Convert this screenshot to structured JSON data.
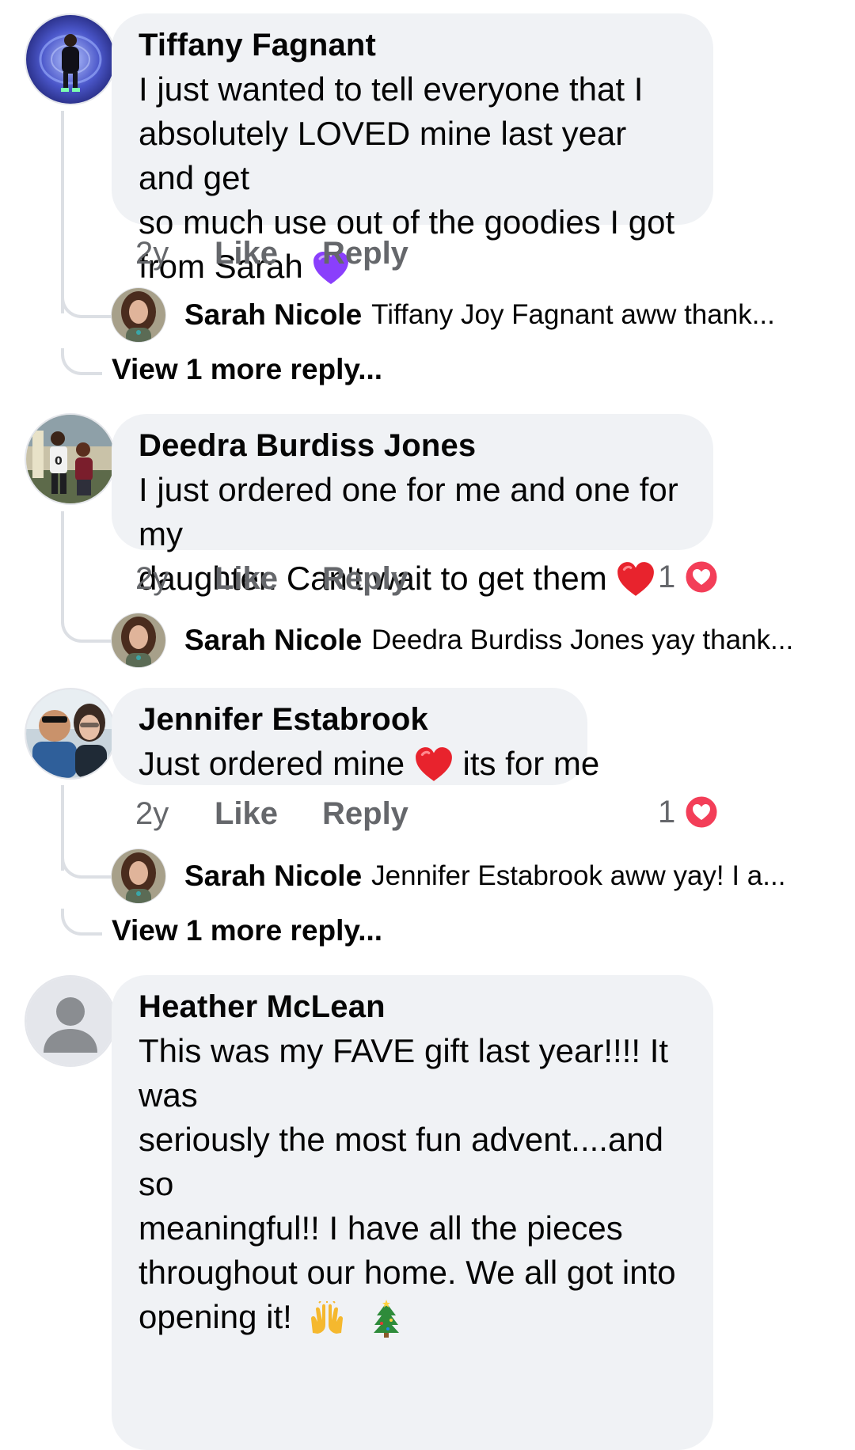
{
  "comments": [
    {
      "author": "Tiffany Fagnant",
      "text_lines": [
        "I just wanted to tell everyone that I",
        "absolutely LOVED mine last year and get",
        "so much use out of the goodies I got",
        "from Sarah"
      ],
      "emoji": "purple-heart",
      "time": "2y",
      "like": "Like",
      "reply": "Reply",
      "reply_preview": {
        "name": "Sarah Nicole",
        "text": "Tiffany Joy Fagnant aww thank..."
      },
      "view_more": "View 1 more reply..."
    },
    {
      "author": "Deedra Burdiss Jones",
      "text_lines": [
        "I just ordered one for me and one for my",
        "daughter. Can't wait to get them"
      ],
      "emoji": "red-heart",
      "time": "2y",
      "like": "Like",
      "reply": "Reply",
      "reaction_count": "1",
      "reply_preview": {
        "name": "Sarah Nicole",
        "text": "Deedra Burdiss Jones yay thank..."
      }
    },
    {
      "author": "Jennifer Estabrook",
      "text_before": "Just ordered mine",
      "text_after": "its for me",
      "emoji": "red-heart",
      "time": "2y",
      "like": "Like",
      "reply": "Reply",
      "reaction_count": "1",
      "reply_preview": {
        "name": "Sarah Nicole",
        "text": "Jennifer Estabrook aww yay! I a..."
      },
      "view_more": "View 1 more reply..."
    },
    {
      "author": "Heather McLean",
      "text_lines": [
        "This was my FAVE gift last year!!!! It was",
        "seriously the most fun advent....and so",
        "meaningful!! I have all the pieces",
        "throughout our home. We all got into",
        "opening it!"
      ],
      "emojis": [
        "raising-hands",
        "christmas-tree"
      ]
    }
  ],
  "colors": {
    "bubble": "#f0f2f5",
    "meta_text": "#65676b",
    "love_react": "#f33e58",
    "purple_heart": "#8a3ffc",
    "red_heart": "#e8232d"
  }
}
